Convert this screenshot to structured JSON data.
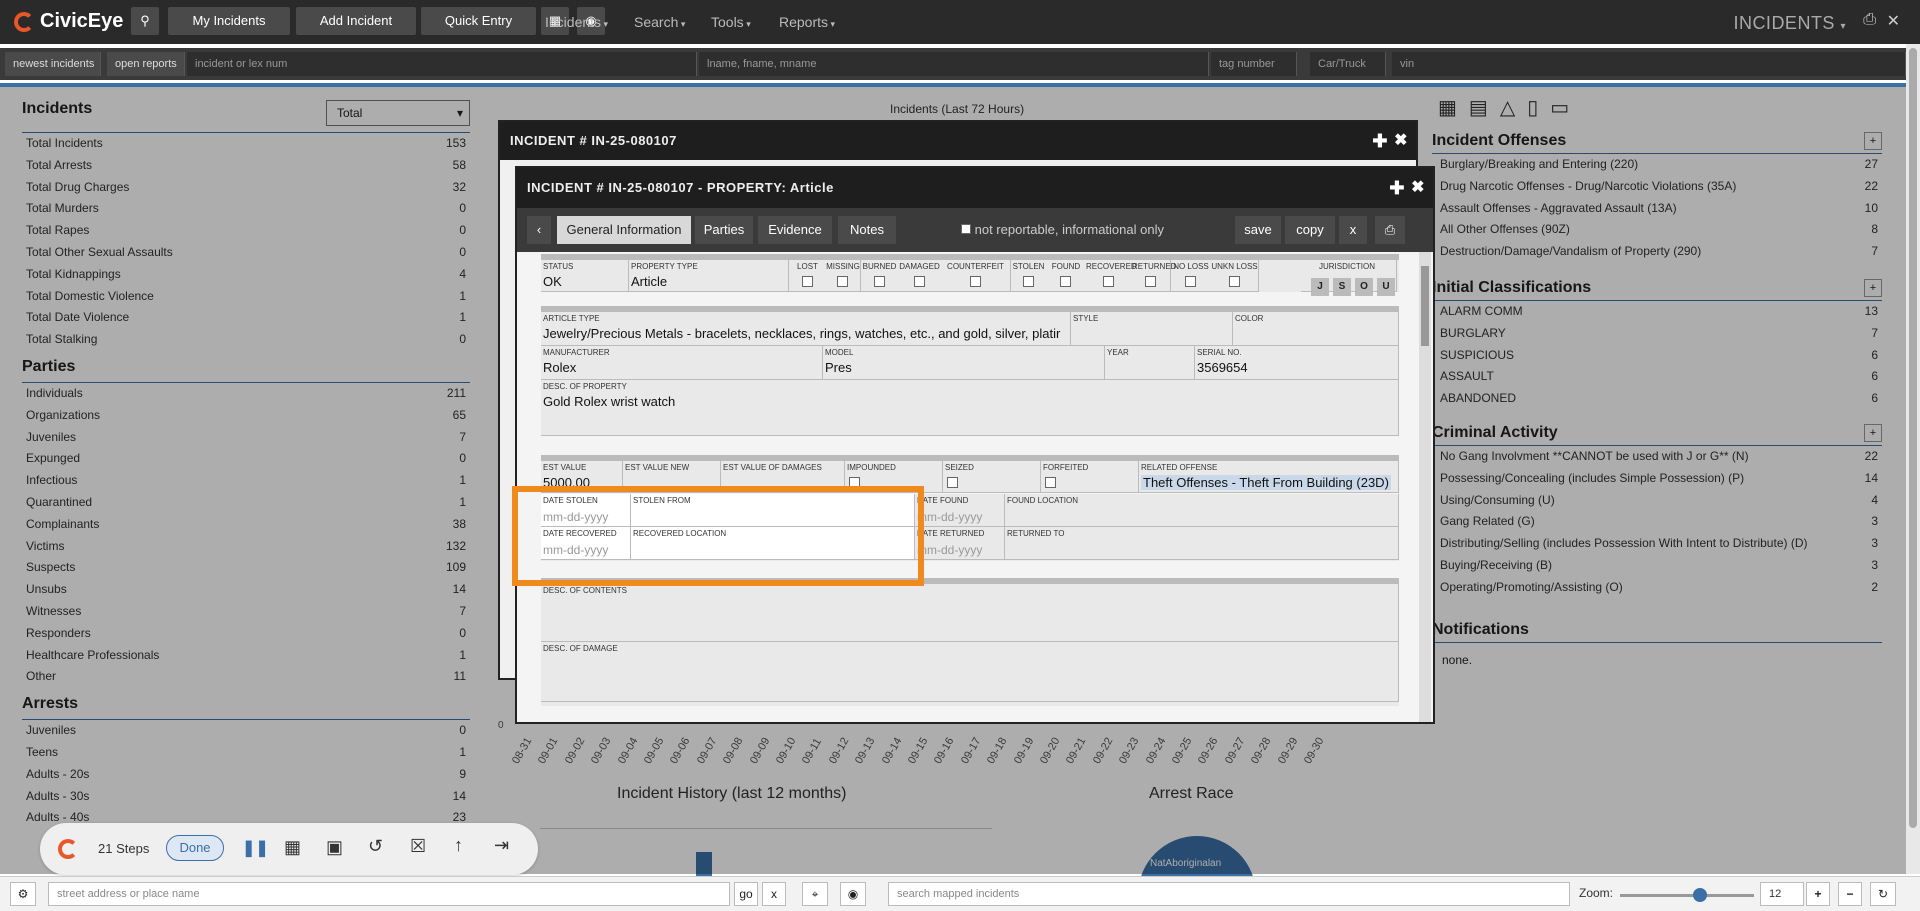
{
  "app": {
    "name": "CivicEye",
    "page_title": "INCIDENTS"
  },
  "topbar": {
    "buttons": [
      "My Incidents",
      "Add Incident",
      "Quick Entry"
    ],
    "menus": [
      "Incidents",
      "Search",
      "Tools",
      "Reports"
    ]
  },
  "search": {
    "newest": "newest incidents",
    "open": "open reports",
    "incident_ph": "incident or lex num",
    "name_ph": "lname, fname, mname",
    "tag_ph": "tag number",
    "vehicle_ph": "Car/Truck",
    "vin_ph": "vin"
  },
  "left": {
    "incidents_title": "Incidents",
    "filter_value": "Total",
    "incidents": [
      {
        "label": "Total Incidents",
        "count": "153"
      },
      {
        "label": "Total Arrests",
        "count": "58"
      },
      {
        "label": "Total Drug Charges",
        "count": "32"
      },
      {
        "label": "Total Murders",
        "count": "0"
      },
      {
        "label": "Total Rapes",
        "count": "0"
      },
      {
        "label": "Total Other Sexual Assaults",
        "count": "0"
      },
      {
        "label": "Total Kidnappings",
        "count": "4"
      },
      {
        "label": "Total Domestic Violence",
        "count": "1"
      },
      {
        "label": "Total Date Violence",
        "count": "1"
      },
      {
        "label": "Total Stalking",
        "count": "0"
      }
    ],
    "parties_title": "Parties",
    "parties": [
      {
        "label": "Individuals",
        "count": "211"
      },
      {
        "label": "Organizations",
        "count": "65"
      },
      {
        "label": "Juveniles",
        "count": "7"
      },
      {
        "label": "Expunged",
        "count": "0"
      },
      {
        "label": "Infectious",
        "count": "1"
      },
      {
        "label": "Quarantined",
        "count": "1"
      },
      {
        "label": "Complainants",
        "count": "38"
      },
      {
        "label": "Victims",
        "count": "132"
      },
      {
        "label": "Suspects",
        "count": "109"
      },
      {
        "label": "Unsubs",
        "count": "14"
      },
      {
        "label": "Witnesses",
        "count": "7"
      },
      {
        "label": "Responders",
        "count": "0"
      },
      {
        "label": "Healthcare Professionals",
        "count": "1"
      },
      {
        "label": "Other",
        "count": "11"
      }
    ],
    "arrests_title": "Arrests",
    "arrests": [
      {
        "label": "Juveniles",
        "count": "0"
      },
      {
        "label": "Teens",
        "count": "1"
      },
      {
        "label": "Adults - 20s",
        "count": "9"
      },
      {
        "label": "Adults - 30s",
        "count": "14"
      },
      {
        "label": "Adults - 40s",
        "count": "23"
      }
    ]
  },
  "right": {
    "offenses_title": "Incident Offenses",
    "offenses": [
      {
        "label": "Burglary/Breaking and Entering (220)",
        "count": "27"
      },
      {
        "label": "Drug Narcotic Offenses - Drug/Narcotic Violations (35A)",
        "count": "22"
      },
      {
        "label": "Assault Offenses - Aggravated Assault (13A)",
        "count": "10"
      },
      {
        "label": "All Other Offenses (90Z)",
        "count": "8"
      },
      {
        "label": "Destruction/Damage/Vandalism of Property (290)",
        "count": "7"
      }
    ],
    "classifications_title": "Initial Classifications",
    "classifications": [
      {
        "label": "ALARM COMM",
        "count": "13"
      },
      {
        "label": "BURGLARY",
        "count": "7"
      },
      {
        "label": "SUSPICIOUS",
        "count": "6"
      },
      {
        "label": "ASSAULT",
        "count": "6"
      },
      {
        "label": "ABANDONED",
        "count": "6"
      }
    ],
    "criminal_title": "Criminal Activity",
    "criminal": [
      {
        "label": "No Gang Involvment **CANNOT be used with J or G** (N)",
        "count": "22"
      },
      {
        "label": "Possessing/Concealing (includes Simple Possession) (P)",
        "count": "14"
      },
      {
        "label": "Using/Consuming (U)",
        "count": "4"
      },
      {
        "label": "Gang Related (G)",
        "count": "3"
      },
      {
        "label": "Distributing/Selling (includes Possession With Intent to Distribute) (D)",
        "count": "3"
      },
      {
        "label": "Buying/Receiving (B)",
        "count": "3"
      },
      {
        "label": "Operating/Promoting/Assisting (O)",
        "count": "2"
      }
    ],
    "notifications_title": "Notifications",
    "notifications_text": "none."
  },
  "charts": {
    "incidents_72h": "Incidents (Last 72 Hours)",
    "history": "Incident History (last 12 months)",
    "arrest_race": "Arrest Race",
    "race_label": "NatAboriginalan",
    "zero": "0",
    "x_dates": [
      "08-31",
      "09-01",
      "09-02",
      "09-03",
      "09-04",
      "09-05",
      "09-06",
      "09-07",
      "09-08",
      "09-09",
      "09-10",
      "09-11",
      "09-12",
      "09-13",
      "09-14",
      "09-15",
      "09-16",
      "09-17",
      "09-18",
      "09-19",
      "09-20",
      "09-21",
      "09-22",
      "09-23",
      "09-24",
      "09-25",
      "09-26",
      "09-27",
      "09-28",
      "09-29",
      "09-30"
    ]
  },
  "dialog_back": {
    "title": "INCIDENT # IN-25-080107"
  },
  "dialog": {
    "title": "INCIDENT # IN-25-080107 - PROPERTY: Article",
    "tabs": [
      "General Information",
      "Parties",
      "Evidence",
      "Notes"
    ],
    "not_reportable": "not reportable, informational only",
    "save": "save",
    "copy": "copy",
    "close": "x",
    "status_label": "STATUS",
    "status_value": "OK",
    "ptype_label": "PROPERTY TYPE",
    "ptype_value": "Article",
    "checks": [
      "LOST",
      "MISSING",
      "BURNED",
      "DAMAGED",
      "COUNTERFEIT",
      "STOLEN",
      "FOUND",
      "RECOVERED",
      "RETURNED",
      "NO LOSS",
      "UNKN LOSS"
    ],
    "jurisdiction_label": "JURISDICTION",
    "jurisdiction": [
      "J",
      "S",
      "O",
      "U"
    ],
    "article_type_label": "ARTICLE TYPE",
    "article_type_value": "Jewelry/Precious Metals - bracelets, necklaces, rings, watches, etc., and gold, silver, platir",
    "style_label": "STYLE",
    "color_label": "COLOR",
    "manufacturer_label": "MANUFACTURER",
    "manufacturer_value": "Rolex",
    "model_label": "MODEL",
    "model_value": "Pres",
    "year_label": "YEAR",
    "serial_label": "SERIAL NO.",
    "serial_value": "3569654",
    "desc_label": "DESC. OF PROPERTY",
    "desc_value": "Gold Rolex wrist watch",
    "est_value_label": "EST VALUE",
    "est_value_value": "5000.00",
    "est_new_label": "EST VALUE NEW",
    "est_damage_label": "EST VALUE OF DAMAGES",
    "impounded_label": "IMPOUNDED",
    "seized_label": "SEIZED",
    "forfeited_label": "FORFEITED",
    "related_label": "RELATED OFFENSE",
    "related_value": "Theft Offenses - Theft From Building (23D)",
    "date_stolen_label": "DATE STOLEN",
    "stolen_from_label": "STOLEN FROM",
    "date_found_label": "DATE FOUND",
    "found_location_label": "FOUND LOCATION",
    "date_recovered_label": "DATE RECOVERED",
    "recovered_location_label": "RECOVERED LOCATION",
    "date_returned_label": "DATE RETURNED",
    "returned_to_label": "RETURNED TO",
    "date_ph": "mm-dd-yyyy",
    "contents_label": "DESC. OF CONTENTS",
    "damage_label": "DESC. OF DAMAGE"
  },
  "recorder": {
    "steps": "21 Steps",
    "done": "Done"
  },
  "bottom": {
    "address_ph": "street address or place name",
    "go": "go",
    "x": "x",
    "mapped_ph": "search mapped incidents",
    "zoom_label": "Zoom:",
    "zoom_value": "12",
    "zoom_level": 0.6
  },
  "colors": {
    "accent": "#3b6fa8",
    "brand": "#e8562a",
    "highlight": "#f08a1c"
  }
}
